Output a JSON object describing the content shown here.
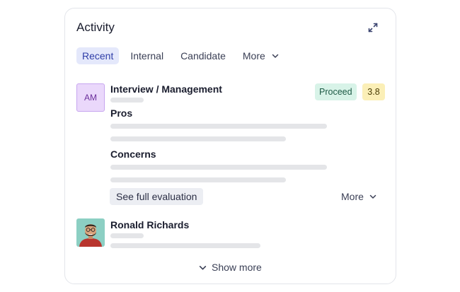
{
  "card": {
    "title": "Activity",
    "expand_icon": "expand-arrows-icon"
  },
  "tabs": [
    {
      "label": "Recent",
      "active": true
    },
    {
      "label": "Internal",
      "active": false
    },
    {
      "label": "Candidate",
      "active": false
    },
    {
      "label": "More",
      "active": false,
      "icon": "chevron-down-icon"
    }
  ],
  "activity_1": {
    "avatar_initials": "AM",
    "title": "Interview / Management",
    "status_badge": "Proceed",
    "score_badge": "3.8",
    "pros_label": "Pros",
    "concerns_label": "Concerns",
    "see_full_label": "See full evaluation",
    "more_label": "More"
  },
  "activity_2": {
    "name": "Ronald Richards"
  },
  "footer": {
    "show_more_label": "Show more"
  },
  "colors": {
    "accent_tab_bg": "#e4e8fb",
    "accent_tab_text": "#2f3ea8",
    "proceed_bg": "#d8f3e8",
    "score_bg": "#fbefb7",
    "avatar_am_bg": "#ead8fb",
    "skeleton": "#e4e5e8"
  }
}
